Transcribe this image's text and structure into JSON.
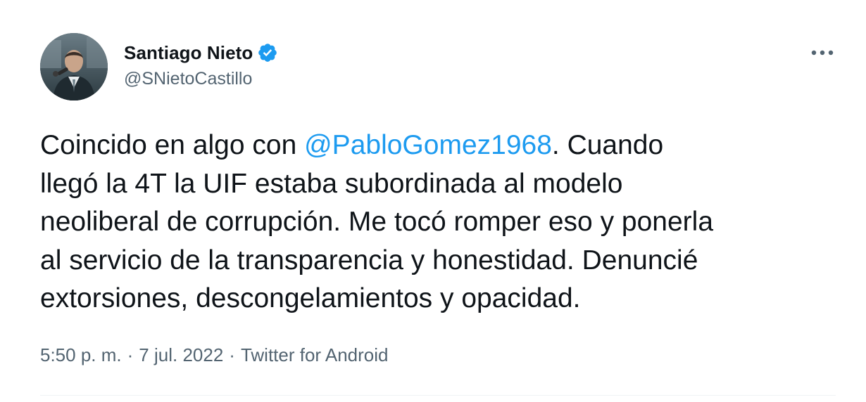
{
  "author": {
    "display_name": "Santiago Nieto",
    "handle": "@SNietoCastillo",
    "verified": true
  },
  "tweet": {
    "lines": [
      {
        "before": "Coincido en algo con ",
        "mention": "@PabloGomez1968",
        "after": ". Cuando"
      },
      {
        "text": "llegó la 4T la UIF estaba subordinada al modelo"
      },
      {
        "text": "neoliberal de corrupción. Me tocó romper eso y ponerla"
      },
      {
        "text": "al servicio de la transparencia y honestidad. Denuncié"
      },
      {
        "text": "extorsiones, descongelamientos y opacidad."
      }
    ]
  },
  "meta": {
    "time": "5:50 p. m.",
    "date": "7 jul. 2022",
    "separator": "·",
    "source": "Twitter for Android"
  },
  "icons": {
    "verified": "verified-badge-icon",
    "more": "more-options-icon"
  },
  "colors": {
    "accent": "#1d9bf0",
    "text": "#0f1419",
    "secondary": "#536471"
  }
}
